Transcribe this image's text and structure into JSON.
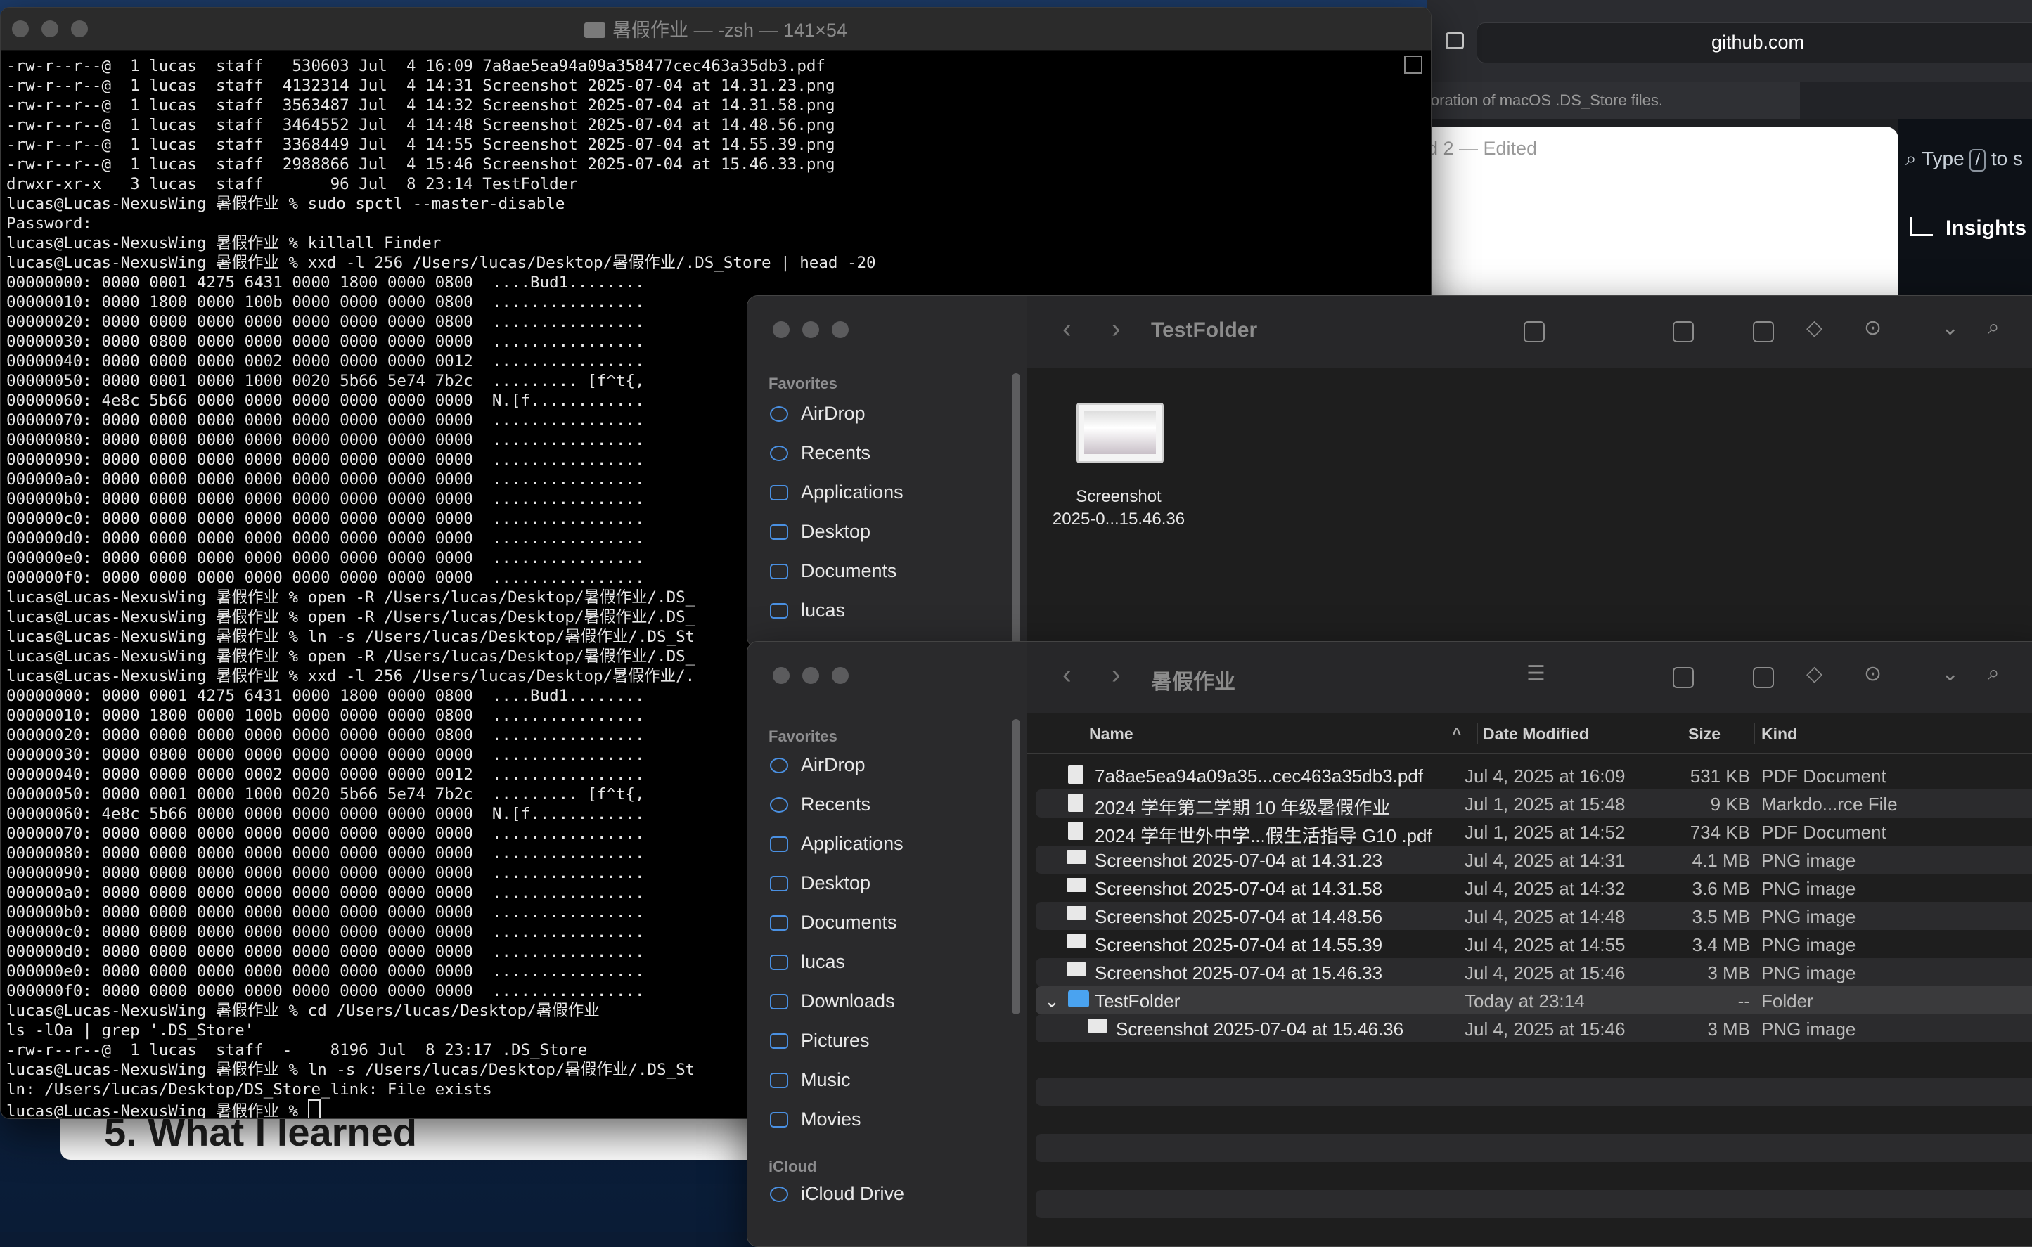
{
  "background_doc": {
    "heading": "5. What I learned"
  },
  "browser": {
    "url": "github.com",
    "tab_text": "loration of macOS .DS_Store files.",
    "edited_text": "d 2 — Edited",
    "search_prefix": "Type",
    "search_key": "/",
    "search_suffix": "to s",
    "insights_label": "Insights"
  },
  "terminal": {
    "title": "暑假作业 — -zsh — 141×54",
    "lines": [
      "-rw-r--r--@  1 lucas  staff   530603 Jul  4 16:09 7a8ae5ea94a09a358477cec463a35db3.pdf",
      "-rw-r--r--@  1 lucas  staff  4132314 Jul  4 14:31 Screenshot 2025-07-04 at 14.31.23.png",
      "-rw-r--r--@  1 lucas  staff  3563487 Jul  4 14:32 Screenshot 2025-07-04 at 14.31.58.png",
      "-rw-r--r--@  1 lucas  staff  3464552 Jul  4 14:48 Screenshot 2025-07-04 at 14.48.56.png",
      "-rw-r--r--@  1 lucas  staff  3368449 Jul  4 14:55 Screenshot 2025-07-04 at 14.55.39.png",
      "-rw-r--r--@  1 lucas  staff  2988866 Jul  4 15:46 Screenshot 2025-07-04 at 15.46.33.png",
      "drwxr-xr-x   3 lucas  staff       96 Jul  8 23:14 TestFolder",
      "lucas@Lucas-NexusWing 暑假作业 % sudo spctl --master-disable",
      "Password:",
      "lucas@Lucas-NexusWing 暑假作业 % killall Finder",
      "lucas@Lucas-NexusWing 暑假作业 % xxd -l 256 /Users/lucas/Desktop/暑假作业/.DS_Store | head -20",
      "00000000: 0000 0001 4275 6431 0000 1800 0000 0800  ....Bud1........",
      "00000010: 0000 1800 0000 100b 0000 0000 0000 0800  ................",
      "00000020: 0000 0000 0000 0000 0000 0000 0000 0800  ................",
      "00000030: 0000 0800 0000 0000 0000 0000 0000 0000  ................",
      "00000040: 0000 0000 0000 0002 0000 0000 0000 0012  ................",
      "00000050: 0000 0001 0000 1000 0020 5b66 5e74 7b2c  ......... [f^t{,",
      "00000060: 4e8c 5b66 0000 0000 0000 0000 0000 0000  N.[f............",
      "00000070: 0000 0000 0000 0000 0000 0000 0000 0000  ................",
      "00000080: 0000 0000 0000 0000 0000 0000 0000 0000  ................",
      "00000090: 0000 0000 0000 0000 0000 0000 0000 0000  ................",
      "000000a0: 0000 0000 0000 0000 0000 0000 0000 0000  ................",
      "000000b0: 0000 0000 0000 0000 0000 0000 0000 0000  ................",
      "000000c0: 0000 0000 0000 0000 0000 0000 0000 0000  ................",
      "000000d0: 0000 0000 0000 0000 0000 0000 0000 0000  ................",
      "000000e0: 0000 0000 0000 0000 0000 0000 0000 0000  ................",
      "000000f0: 0000 0000 0000 0000 0000 0000 0000 0000  ................",
      "lucas@Lucas-NexusWing 暑假作业 % open -R /Users/lucas/Desktop/暑假作业/.DS_",
      "lucas@Lucas-NexusWing 暑假作业 % open -R /Users/lucas/Desktop/暑假作业/.DS_",
      "lucas@Lucas-NexusWing 暑假作业 % ln -s /Users/lucas/Desktop/暑假作业/.DS_St",
      "lucas@Lucas-NexusWing 暑假作业 % open -R /Users/lucas/Desktop/暑假作业/.DS_",
      "lucas@Lucas-NexusWing 暑假作业 % xxd -l 256 /Users/lucas/Desktop/暑假作业/.",
      "00000000: 0000 0001 4275 6431 0000 1800 0000 0800  ....Bud1........",
      "00000010: 0000 1800 0000 100b 0000 0000 0000 0800  ................",
      "00000020: 0000 0000 0000 0000 0000 0000 0000 0800  ................",
      "00000030: 0000 0800 0000 0000 0000 0000 0000 0000  ................",
      "00000040: 0000 0000 0000 0002 0000 0000 0000 0012  ................",
      "00000050: 0000 0001 0000 1000 0020 5b66 5e74 7b2c  ......... [f^t{,",
      "00000060: 4e8c 5b66 0000 0000 0000 0000 0000 0000  N.[f............",
      "00000070: 0000 0000 0000 0000 0000 0000 0000 0000  ................",
      "00000080: 0000 0000 0000 0000 0000 0000 0000 0000  ................",
      "00000090: 0000 0000 0000 0000 0000 0000 0000 0000  ................",
      "000000a0: 0000 0000 0000 0000 0000 0000 0000 0000  ................",
      "000000b0: 0000 0000 0000 0000 0000 0000 0000 0000  ................",
      "000000c0: 0000 0000 0000 0000 0000 0000 0000 0000  ................",
      "000000d0: 0000 0000 0000 0000 0000 0000 0000 0000  ................",
      "000000e0: 0000 0000 0000 0000 0000 0000 0000 0000  ................",
      "000000f0: 0000 0000 0000 0000 0000 0000 0000 0000  ................",
      "lucas@Lucas-NexusWing 暑假作业 % cd /Users/lucas/Desktop/暑假作业",
      "ls -lOa | grep '.DS_Store'",
      "-rw-r--r--@  1 lucas  staff  -    8196 Jul  8 23:17 .DS_Store",
      "lucas@Lucas-NexusWing 暑假作业 % ln -s /Users/lucas/Desktop/暑假作业/.DS_St",
      "ln: /Users/lucas/Desktop/DS_Store_link: File exists"
    ],
    "prompt": "lucas@Lucas-NexusWing 暑假作业 % "
  },
  "finder_top": {
    "folder": "TestFolder",
    "sidebar_section": "Favorites",
    "sidebar_items": [
      "AirDrop",
      "Recents",
      "Applications",
      "Desktop",
      "Documents",
      "lucas"
    ],
    "item_label_1": "Screenshot",
    "item_label_2": "2025-0...15.46.36"
  },
  "finder_main": {
    "folder": "暑假作业",
    "sidebar_section": "Favorites",
    "sidebar_items": [
      "AirDrop",
      "Recents",
      "Applications",
      "Desktop",
      "Documents",
      "lucas",
      "Downloads",
      "Pictures",
      "Music",
      "Movies"
    ],
    "icloud_section": "iCloud",
    "icloud_items": [
      "iCloud Drive"
    ],
    "columns": {
      "name": "Name",
      "date": "Date Modified",
      "size": "Size",
      "kind": "Kind"
    },
    "rows": [
      {
        "name": "7a8ae5ea94a09a35...cec463a35db3.pdf",
        "date": "Jul 4, 2025 at 16:09",
        "size": "531 KB",
        "kind": "PDF Document"
      },
      {
        "name": "2024 学年第二学期 10 年级暑假作业",
        "date": "Jul 1, 2025 at 15:48",
        "size": "9 KB",
        "kind": "Markdo...rce File"
      },
      {
        "name": "2024 学年世外中学...假生活指导 G10 .pdf",
        "date": "Jul 1, 2025 at 14:52",
        "size": "734 KB",
        "kind": "PDF Document"
      },
      {
        "name": "Screenshot 2025-07-04 at 14.31.23",
        "date": "Jul 4, 2025 at 14:31",
        "size": "4.1 MB",
        "kind": "PNG image"
      },
      {
        "name": "Screenshot 2025-07-04 at 14.31.58",
        "date": "Jul 4, 2025 at 14:32",
        "size": "3.6 MB",
        "kind": "PNG image"
      },
      {
        "name": "Screenshot 2025-07-04 at 14.48.56",
        "date": "Jul 4, 2025 at 14:48",
        "size": "3.5 MB",
        "kind": "PNG image"
      },
      {
        "name": "Screenshot 2025-07-04 at 14.55.39",
        "date": "Jul 4, 2025 at 14:55",
        "size": "3.4 MB",
        "kind": "PNG image"
      },
      {
        "name": "Screenshot 2025-07-04 at 15.46.33",
        "date": "Jul 4, 2025 at 15:46",
        "size": "3 MB",
        "kind": "PNG image"
      },
      {
        "name": "TestFolder",
        "date": "Today at 23:14",
        "size": "--",
        "kind": "Folder"
      },
      {
        "name": "Screenshot 2025-07-04 at 15.46.36",
        "date": "Jul 4, 2025 at 15:46",
        "size": "3 MB",
        "kind": "PNG image"
      }
    ]
  }
}
